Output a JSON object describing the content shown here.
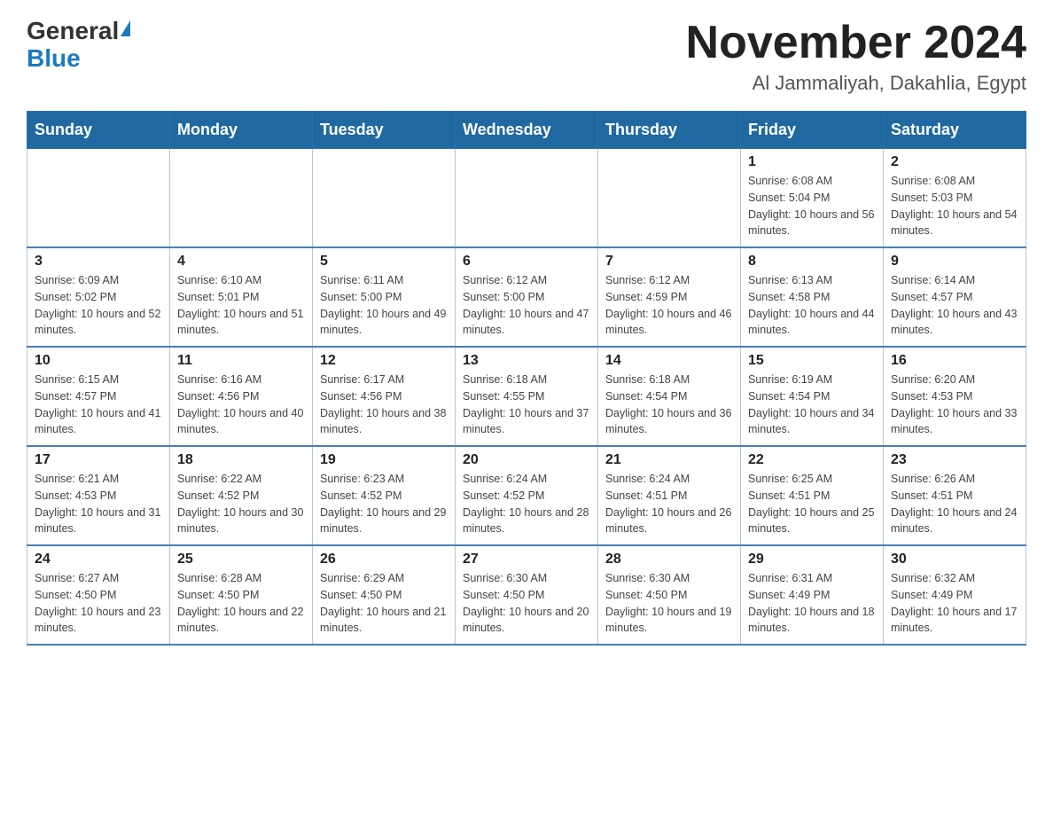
{
  "logo": {
    "general": "General",
    "blue": "Blue"
  },
  "title": "November 2024",
  "subtitle": "Al Jammaliyah, Dakahlia, Egypt",
  "days_of_week": [
    "Sunday",
    "Monday",
    "Tuesday",
    "Wednesday",
    "Thursday",
    "Friday",
    "Saturday"
  ],
  "weeks": [
    [
      null,
      null,
      null,
      null,
      null,
      {
        "day": "1",
        "sunrise": "Sunrise: 6:08 AM",
        "sunset": "Sunset: 5:04 PM",
        "daylight": "Daylight: 10 hours and 56 minutes."
      },
      {
        "day": "2",
        "sunrise": "Sunrise: 6:08 AM",
        "sunset": "Sunset: 5:03 PM",
        "daylight": "Daylight: 10 hours and 54 minutes."
      }
    ],
    [
      {
        "day": "3",
        "sunrise": "Sunrise: 6:09 AM",
        "sunset": "Sunset: 5:02 PM",
        "daylight": "Daylight: 10 hours and 52 minutes."
      },
      {
        "day": "4",
        "sunrise": "Sunrise: 6:10 AM",
        "sunset": "Sunset: 5:01 PM",
        "daylight": "Daylight: 10 hours and 51 minutes."
      },
      {
        "day": "5",
        "sunrise": "Sunrise: 6:11 AM",
        "sunset": "Sunset: 5:00 PM",
        "daylight": "Daylight: 10 hours and 49 minutes."
      },
      {
        "day": "6",
        "sunrise": "Sunrise: 6:12 AM",
        "sunset": "Sunset: 5:00 PM",
        "daylight": "Daylight: 10 hours and 47 minutes."
      },
      {
        "day": "7",
        "sunrise": "Sunrise: 6:12 AM",
        "sunset": "Sunset: 4:59 PM",
        "daylight": "Daylight: 10 hours and 46 minutes."
      },
      {
        "day": "8",
        "sunrise": "Sunrise: 6:13 AM",
        "sunset": "Sunset: 4:58 PM",
        "daylight": "Daylight: 10 hours and 44 minutes."
      },
      {
        "day": "9",
        "sunrise": "Sunrise: 6:14 AM",
        "sunset": "Sunset: 4:57 PM",
        "daylight": "Daylight: 10 hours and 43 minutes."
      }
    ],
    [
      {
        "day": "10",
        "sunrise": "Sunrise: 6:15 AM",
        "sunset": "Sunset: 4:57 PM",
        "daylight": "Daylight: 10 hours and 41 minutes."
      },
      {
        "day": "11",
        "sunrise": "Sunrise: 6:16 AM",
        "sunset": "Sunset: 4:56 PM",
        "daylight": "Daylight: 10 hours and 40 minutes."
      },
      {
        "day": "12",
        "sunrise": "Sunrise: 6:17 AM",
        "sunset": "Sunset: 4:56 PM",
        "daylight": "Daylight: 10 hours and 38 minutes."
      },
      {
        "day": "13",
        "sunrise": "Sunrise: 6:18 AM",
        "sunset": "Sunset: 4:55 PM",
        "daylight": "Daylight: 10 hours and 37 minutes."
      },
      {
        "day": "14",
        "sunrise": "Sunrise: 6:18 AM",
        "sunset": "Sunset: 4:54 PM",
        "daylight": "Daylight: 10 hours and 36 minutes."
      },
      {
        "day": "15",
        "sunrise": "Sunrise: 6:19 AM",
        "sunset": "Sunset: 4:54 PM",
        "daylight": "Daylight: 10 hours and 34 minutes."
      },
      {
        "day": "16",
        "sunrise": "Sunrise: 6:20 AM",
        "sunset": "Sunset: 4:53 PM",
        "daylight": "Daylight: 10 hours and 33 minutes."
      }
    ],
    [
      {
        "day": "17",
        "sunrise": "Sunrise: 6:21 AM",
        "sunset": "Sunset: 4:53 PM",
        "daylight": "Daylight: 10 hours and 31 minutes."
      },
      {
        "day": "18",
        "sunrise": "Sunrise: 6:22 AM",
        "sunset": "Sunset: 4:52 PM",
        "daylight": "Daylight: 10 hours and 30 minutes."
      },
      {
        "day": "19",
        "sunrise": "Sunrise: 6:23 AM",
        "sunset": "Sunset: 4:52 PM",
        "daylight": "Daylight: 10 hours and 29 minutes."
      },
      {
        "day": "20",
        "sunrise": "Sunrise: 6:24 AM",
        "sunset": "Sunset: 4:52 PM",
        "daylight": "Daylight: 10 hours and 28 minutes."
      },
      {
        "day": "21",
        "sunrise": "Sunrise: 6:24 AM",
        "sunset": "Sunset: 4:51 PM",
        "daylight": "Daylight: 10 hours and 26 minutes."
      },
      {
        "day": "22",
        "sunrise": "Sunrise: 6:25 AM",
        "sunset": "Sunset: 4:51 PM",
        "daylight": "Daylight: 10 hours and 25 minutes."
      },
      {
        "day": "23",
        "sunrise": "Sunrise: 6:26 AM",
        "sunset": "Sunset: 4:51 PM",
        "daylight": "Daylight: 10 hours and 24 minutes."
      }
    ],
    [
      {
        "day": "24",
        "sunrise": "Sunrise: 6:27 AM",
        "sunset": "Sunset: 4:50 PM",
        "daylight": "Daylight: 10 hours and 23 minutes."
      },
      {
        "day": "25",
        "sunrise": "Sunrise: 6:28 AM",
        "sunset": "Sunset: 4:50 PM",
        "daylight": "Daylight: 10 hours and 22 minutes."
      },
      {
        "day": "26",
        "sunrise": "Sunrise: 6:29 AM",
        "sunset": "Sunset: 4:50 PM",
        "daylight": "Daylight: 10 hours and 21 minutes."
      },
      {
        "day": "27",
        "sunrise": "Sunrise: 6:30 AM",
        "sunset": "Sunset: 4:50 PM",
        "daylight": "Daylight: 10 hours and 20 minutes."
      },
      {
        "day": "28",
        "sunrise": "Sunrise: 6:30 AM",
        "sunset": "Sunset: 4:50 PM",
        "daylight": "Daylight: 10 hours and 19 minutes."
      },
      {
        "day": "29",
        "sunrise": "Sunrise: 6:31 AM",
        "sunset": "Sunset: 4:49 PM",
        "daylight": "Daylight: 10 hours and 18 minutes."
      },
      {
        "day": "30",
        "sunrise": "Sunrise: 6:32 AM",
        "sunset": "Sunset: 4:49 PM",
        "daylight": "Daylight: 10 hours and 17 minutes."
      }
    ]
  ]
}
